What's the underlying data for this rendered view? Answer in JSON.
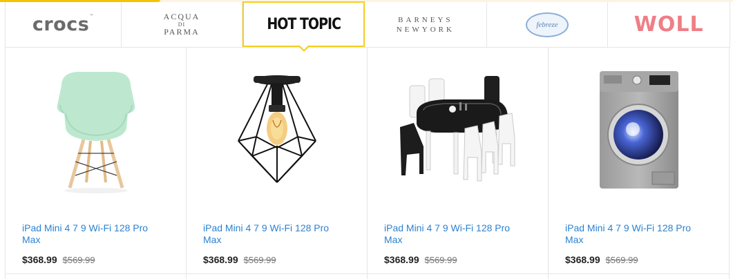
{
  "brands": [
    {
      "name": "crocs",
      "active": false
    },
    {
      "name": "ACQUA DI PARMA",
      "line1": "ACQUA",
      "line2": "DI",
      "line3": "PARMA",
      "active": false
    },
    {
      "name": "HOT TOPIC",
      "active": true
    },
    {
      "name": "BARNEYS NEW YORK",
      "line1": "BARNEYS",
      "line2": "NEWYORK",
      "active": false
    },
    {
      "name": "febreze",
      "active": false
    },
    {
      "name": "WOLL",
      "active": false
    }
  ],
  "products": [
    {
      "image": "green-armchair-image",
      "title": "iPad Mini 4 7 9 Wi-Fi 128 Pro Max",
      "price": "$368.99",
      "old_price": "$569.99"
    },
    {
      "image": "ceiling-lamp-image",
      "title": "iPad Mini 4 7 9 Wi-Fi 128 Pro Max",
      "price": "$368.99",
      "old_price": "$569.99"
    },
    {
      "image": "dining-table-set-image",
      "title": "iPad Mini 4 7 9 Wi-Fi 128 Pro Max",
      "price": "$368.99",
      "old_price": "$569.99"
    },
    {
      "image": "washing-machine-image",
      "title": "iPad Mini 4 7 9 Wi-Fi 128 Pro Max",
      "price": "$368.99",
      "old_price": "$569.99"
    }
  ],
  "colors": {
    "accent": "#f5cf1a",
    "link": "#2b82d1",
    "border": "#e5e5e5",
    "woll": "#ef7e86",
    "febreze": "#8aaed6"
  }
}
